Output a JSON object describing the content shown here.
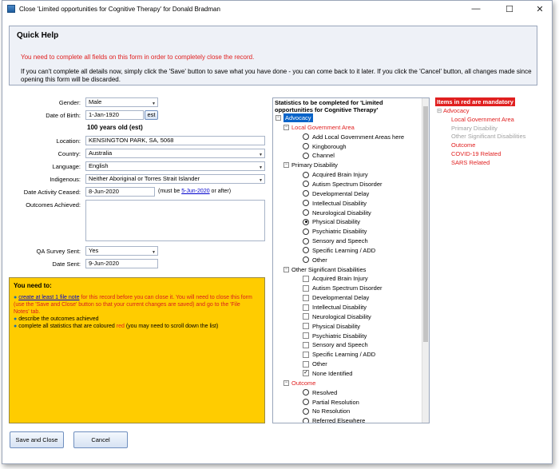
{
  "window": {
    "title": "Close 'Limited opportunities for Cognitive Therapy' for Donald Bradman",
    "minimize": "—",
    "maximize": "☐",
    "close": "✕"
  },
  "quick_help": {
    "heading": "Quick Help",
    "warning": "You need to complete all fields on this form in order to completely close the record.",
    "info": "If you can't complete all details now, simply click the 'Save' button to save what you have done - you can come back to it later. If you click the 'Cancel' button, all changes made since opening this form will be discarded."
  },
  "form": {
    "gender_label": "Gender:",
    "gender_value": "Male",
    "dob_label": "Date of Birth:",
    "dob_value": "1-Jan-1920",
    "est_button": "est",
    "age_text": "100 years old (est)",
    "location_label": "Location:",
    "location_value": "KENSINGTON PARK, SA, 5068",
    "country_label": "Country:",
    "country_value": "Australia",
    "language_label": "Language:",
    "language_value": "English",
    "indigenous_label": "Indigenous:",
    "indigenous_value": "Neither Aboriginal or Torres Strait Islander",
    "ceased_label": "Date Activity Ceased:",
    "ceased_value": "8-Jun-2020",
    "ceased_note_pre": "(must be ",
    "ceased_note_link": "5-Jun-2020",
    "ceased_note_post": " or after)",
    "outcomes_label": "Outcomes Achieved:",
    "outcomes_value": "",
    "qa_label": "QA Survey Sent:",
    "qa_value": "Yes",
    "date_sent_label": "Date Sent:",
    "date_sent_value": "9-Jun-2020"
  },
  "todo": {
    "heading": "You need to:",
    "item1_link": "create at least 1 file note",
    "item1_text": " for this record before you can close it. You will need to close this form (use the 'Save and Close' button so that your current changes are saved) and go to the 'File Notes' tab.",
    "item2": "describe the outcomes achieved",
    "item3_pre": "complete all statistics that are coloured ",
    "item3_red": "red",
    "item3_post": " (you may need to scroll down the list)"
  },
  "stats": {
    "heading": "Statistics to be completed for 'Limited opportunities for Cognitive Therapy'",
    "rows": [
      {
        "text": "Advocacy",
        "kind": "group",
        "level": 0,
        "selected": true
      },
      {
        "text": "Local Government Area",
        "kind": "group",
        "level": 1,
        "red": true
      },
      {
        "text": "Add Local Government Areas here",
        "kind": "radio",
        "level": 2
      },
      {
        "text": "Kingborough",
        "kind": "radio",
        "level": 2
      },
      {
        "text": "Channel",
        "kind": "radio",
        "level": 2
      },
      {
        "text": "Primary Disability",
        "kind": "group",
        "level": 1
      },
      {
        "text": "Acquired Brain Injury",
        "kind": "radio",
        "level": 2
      },
      {
        "text": "Autism Spectrum Disorder",
        "kind": "radio",
        "level": 2
      },
      {
        "text": "Developmental Delay",
        "kind": "radio",
        "level": 2
      },
      {
        "text": "Intellectual Disability",
        "kind": "radio",
        "level": 2
      },
      {
        "text": "Neurological Disability",
        "kind": "radio",
        "level": 2
      },
      {
        "text": "Physical Disability",
        "kind": "radio",
        "level": 2,
        "checked": true
      },
      {
        "text": "Psychiatric Disability",
        "kind": "radio",
        "level": 2
      },
      {
        "text": "Sensory and Speech",
        "kind": "radio",
        "level": 2
      },
      {
        "text": "Specific Learning / ADD",
        "kind": "radio",
        "level": 2
      },
      {
        "text": "Other",
        "kind": "radio",
        "level": 2
      },
      {
        "text": "Other Significant Disabilities",
        "kind": "group",
        "level": 1
      },
      {
        "text": "Acquired Brain Injury",
        "kind": "check",
        "level": 2
      },
      {
        "text": "Autism Spectrum Disorder",
        "kind": "check",
        "level": 2
      },
      {
        "text": "Developmental Delay",
        "kind": "check",
        "level": 2
      },
      {
        "text": "Intellectual Disability",
        "kind": "check",
        "level": 2
      },
      {
        "text": "Neurological Disability",
        "kind": "check",
        "level": 2
      },
      {
        "text": "Physical Disability",
        "kind": "check",
        "level": 2
      },
      {
        "text": "Psychiatric Disability",
        "kind": "check",
        "level": 2
      },
      {
        "text": "Sensory and Speech",
        "kind": "check",
        "level": 2
      },
      {
        "text": "Specific Learning / ADD",
        "kind": "check",
        "level": 2
      },
      {
        "text": "Other",
        "kind": "check",
        "level": 2
      },
      {
        "text": "None Identified",
        "kind": "check",
        "level": 2,
        "checked": true
      },
      {
        "text": "Outcome",
        "kind": "group",
        "level": 1,
        "red": true
      },
      {
        "text": "Resolved",
        "kind": "radio",
        "level": 2
      },
      {
        "text": "Partial Resolution",
        "kind": "radio",
        "level": 2
      },
      {
        "text": "No Resolution",
        "kind": "radio",
        "level": 2
      },
      {
        "text": "Referred Elsewhere",
        "kind": "radio",
        "level": 2
      }
    ]
  },
  "mandatory": {
    "heading": "Items in red are mandatory",
    "items": [
      {
        "text": "Advocacy",
        "level": 0,
        "red": true
      },
      {
        "text": "Local Government Area",
        "level": 1,
        "red": true
      },
      {
        "text": "Primary Disability",
        "level": 1,
        "red": false
      },
      {
        "text": "Other Significant Disabilities",
        "level": 1,
        "red": false
      },
      {
        "text": "Outcome",
        "level": 1,
        "red": true
      },
      {
        "text": "COVID-19 Related",
        "level": 1,
        "red": true
      },
      {
        "text": "SARS Related",
        "level": 1,
        "red": true
      }
    ]
  },
  "buttons": {
    "save_close": "Save and Close",
    "cancel": "Cancel"
  },
  "colors": {
    "mandatory_red": "#e02020",
    "todo_background": "#ffcc00",
    "selection_blue": "#0a64c8"
  }
}
